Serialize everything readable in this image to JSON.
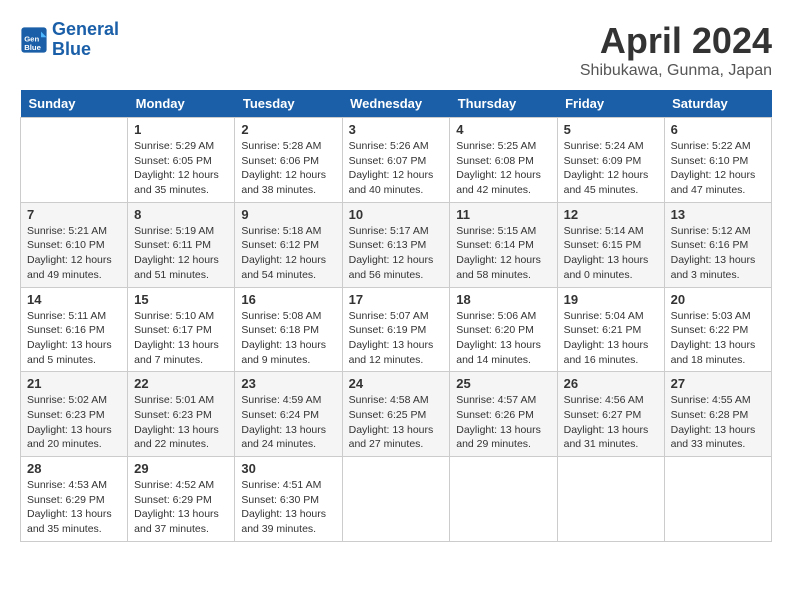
{
  "header": {
    "logo_line1": "General",
    "logo_line2": "Blue",
    "month": "April 2024",
    "location": "Shibukawa, Gunma, Japan"
  },
  "days_of_week": [
    "Sunday",
    "Monday",
    "Tuesday",
    "Wednesday",
    "Thursday",
    "Friday",
    "Saturday"
  ],
  "weeks": [
    [
      {
        "day": "",
        "info": ""
      },
      {
        "day": "1",
        "info": "Sunrise: 5:29 AM\nSunset: 6:05 PM\nDaylight: 12 hours\nand 35 minutes."
      },
      {
        "day": "2",
        "info": "Sunrise: 5:28 AM\nSunset: 6:06 PM\nDaylight: 12 hours\nand 38 minutes."
      },
      {
        "day": "3",
        "info": "Sunrise: 5:26 AM\nSunset: 6:07 PM\nDaylight: 12 hours\nand 40 minutes."
      },
      {
        "day": "4",
        "info": "Sunrise: 5:25 AM\nSunset: 6:08 PM\nDaylight: 12 hours\nand 42 minutes."
      },
      {
        "day": "5",
        "info": "Sunrise: 5:24 AM\nSunset: 6:09 PM\nDaylight: 12 hours\nand 45 minutes."
      },
      {
        "day": "6",
        "info": "Sunrise: 5:22 AM\nSunset: 6:10 PM\nDaylight: 12 hours\nand 47 minutes."
      }
    ],
    [
      {
        "day": "7",
        "info": "Sunrise: 5:21 AM\nSunset: 6:10 PM\nDaylight: 12 hours\nand 49 minutes."
      },
      {
        "day": "8",
        "info": "Sunrise: 5:19 AM\nSunset: 6:11 PM\nDaylight: 12 hours\nand 51 minutes."
      },
      {
        "day": "9",
        "info": "Sunrise: 5:18 AM\nSunset: 6:12 PM\nDaylight: 12 hours\nand 54 minutes."
      },
      {
        "day": "10",
        "info": "Sunrise: 5:17 AM\nSunset: 6:13 PM\nDaylight: 12 hours\nand 56 minutes."
      },
      {
        "day": "11",
        "info": "Sunrise: 5:15 AM\nSunset: 6:14 PM\nDaylight: 12 hours\nand 58 minutes."
      },
      {
        "day": "12",
        "info": "Sunrise: 5:14 AM\nSunset: 6:15 PM\nDaylight: 13 hours\nand 0 minutes."
      },
      {
        "day": "13",
        "info": "Sunrise: 5:12 AM\nSunset: 6:16 PM\nDaylight: 13 hours\nand 3 minutes."
      }
    ],
    [
      {
        "day": "14",
        "info": "Sunrise: 5:11 AM\nSunset: 6:16 PM\nDaylight: 13 hours\nand 5 minutes."
      },
      {
        "day": "15",
        "info": "Sunrise: 5:10 AM\nSunset: 6:17 PM\nDaylight: 13 hours\nand 7 minutes."
      },
      {
        "day": "16",
        "info": "Sunrise: 5:08 AM\nSunset: 6:18 PM\nDaylight: 13 hours\nand 9 minutes."
      },
      {
        "day": "17",
        "info": "Sunrise: 5:07 AM\nSunset: 6:19 PM\nDaylight: 13 hours\nand 12 minutes."
      },
      {
        "day": "18",
        "info": "Sunrise: 5:06 AM\nSunset: 6:20 PM\nDaylight: 13 hours\nand 14 minutes."
      },
      {
        "day": "19",
        "info": "Sunrise: 5:04 AM\nSunset: 6:21 PM\nDaylight: 13 hours\nand 16 minutes."
      },
      {
        "day": "20",
        "info": "Sunrise: 5:03 AM\nSunset: 6:22 PM\nDaylight: 13 hours\nand 18 minutes."
      }
    ],
    [
      {
        "day": "21",
        "info": "Sunrise: 5:02 AM\nSunset: 6:23 PM\nDaylight: 13 hours\nand 20 minutes."
      },
      {
        "day": "22",
        "info": "Sunrise: 5:01 AM\nSunset: 6:23 PM\nDaylight: 13 hours\nand 22 minutes."
      },
      {
        "day": "23",
        "info": "Sunrise: 4:59 AM\nSunset: 6:24 PM\nDaylight: 13 hours\nand 24 minutes."
      },
      {
        "day": "24",
        "info": "Sunrise: 4:58 AM\nSunset: 6:25 PM\nDaylight: 13 hours\nand 27 minutes."
      },
      {
        "day": "25",
        "info": "Sunrise: 4:57 AM\nSunset: 6:26 PM\nDaylight: 13 hours\nand 29 minutes."
      },
      {
        "day": "26",
        "info": "Sunrise: 4:56 AM\nSunset: 6:27 PM\nDaylight: 13 hours\nand 31 minutes."
      },
      {
        "day": "27",
        "info": "Sunrise: 4:55 AM\nSunset: 6:28 PM\nDaylight: 13 hours\nand 33 minutes."
      }
    ],
    [
      {
        "day": "28",
        "info": "Sunrise: 4:53 AM\nSunset: 6:29 PM\nDaylight: 13 hours\nand 35 minutes."
      },
      {
        "day": "29",
        "info": "Sunrise: 4:52 AM\nSunset: 6:29 PM\nDaylight: 13 hours\nand 37 minutes."
      },
      {
        "day": "30",
        "info": "Sunrise: 4:51 AM\nSunset: 6:30 PM\nDaylight: 13 hours\nand 39 minutes."
      },
      {
        "day": "",
        "info": ""
      },
      {
        "day": "",
        "info": ""
      },
      {
        "day": "",
        "info": ""
      },
      {
        "day": "",
        "info": ""
      }
    ]
  ]
}
